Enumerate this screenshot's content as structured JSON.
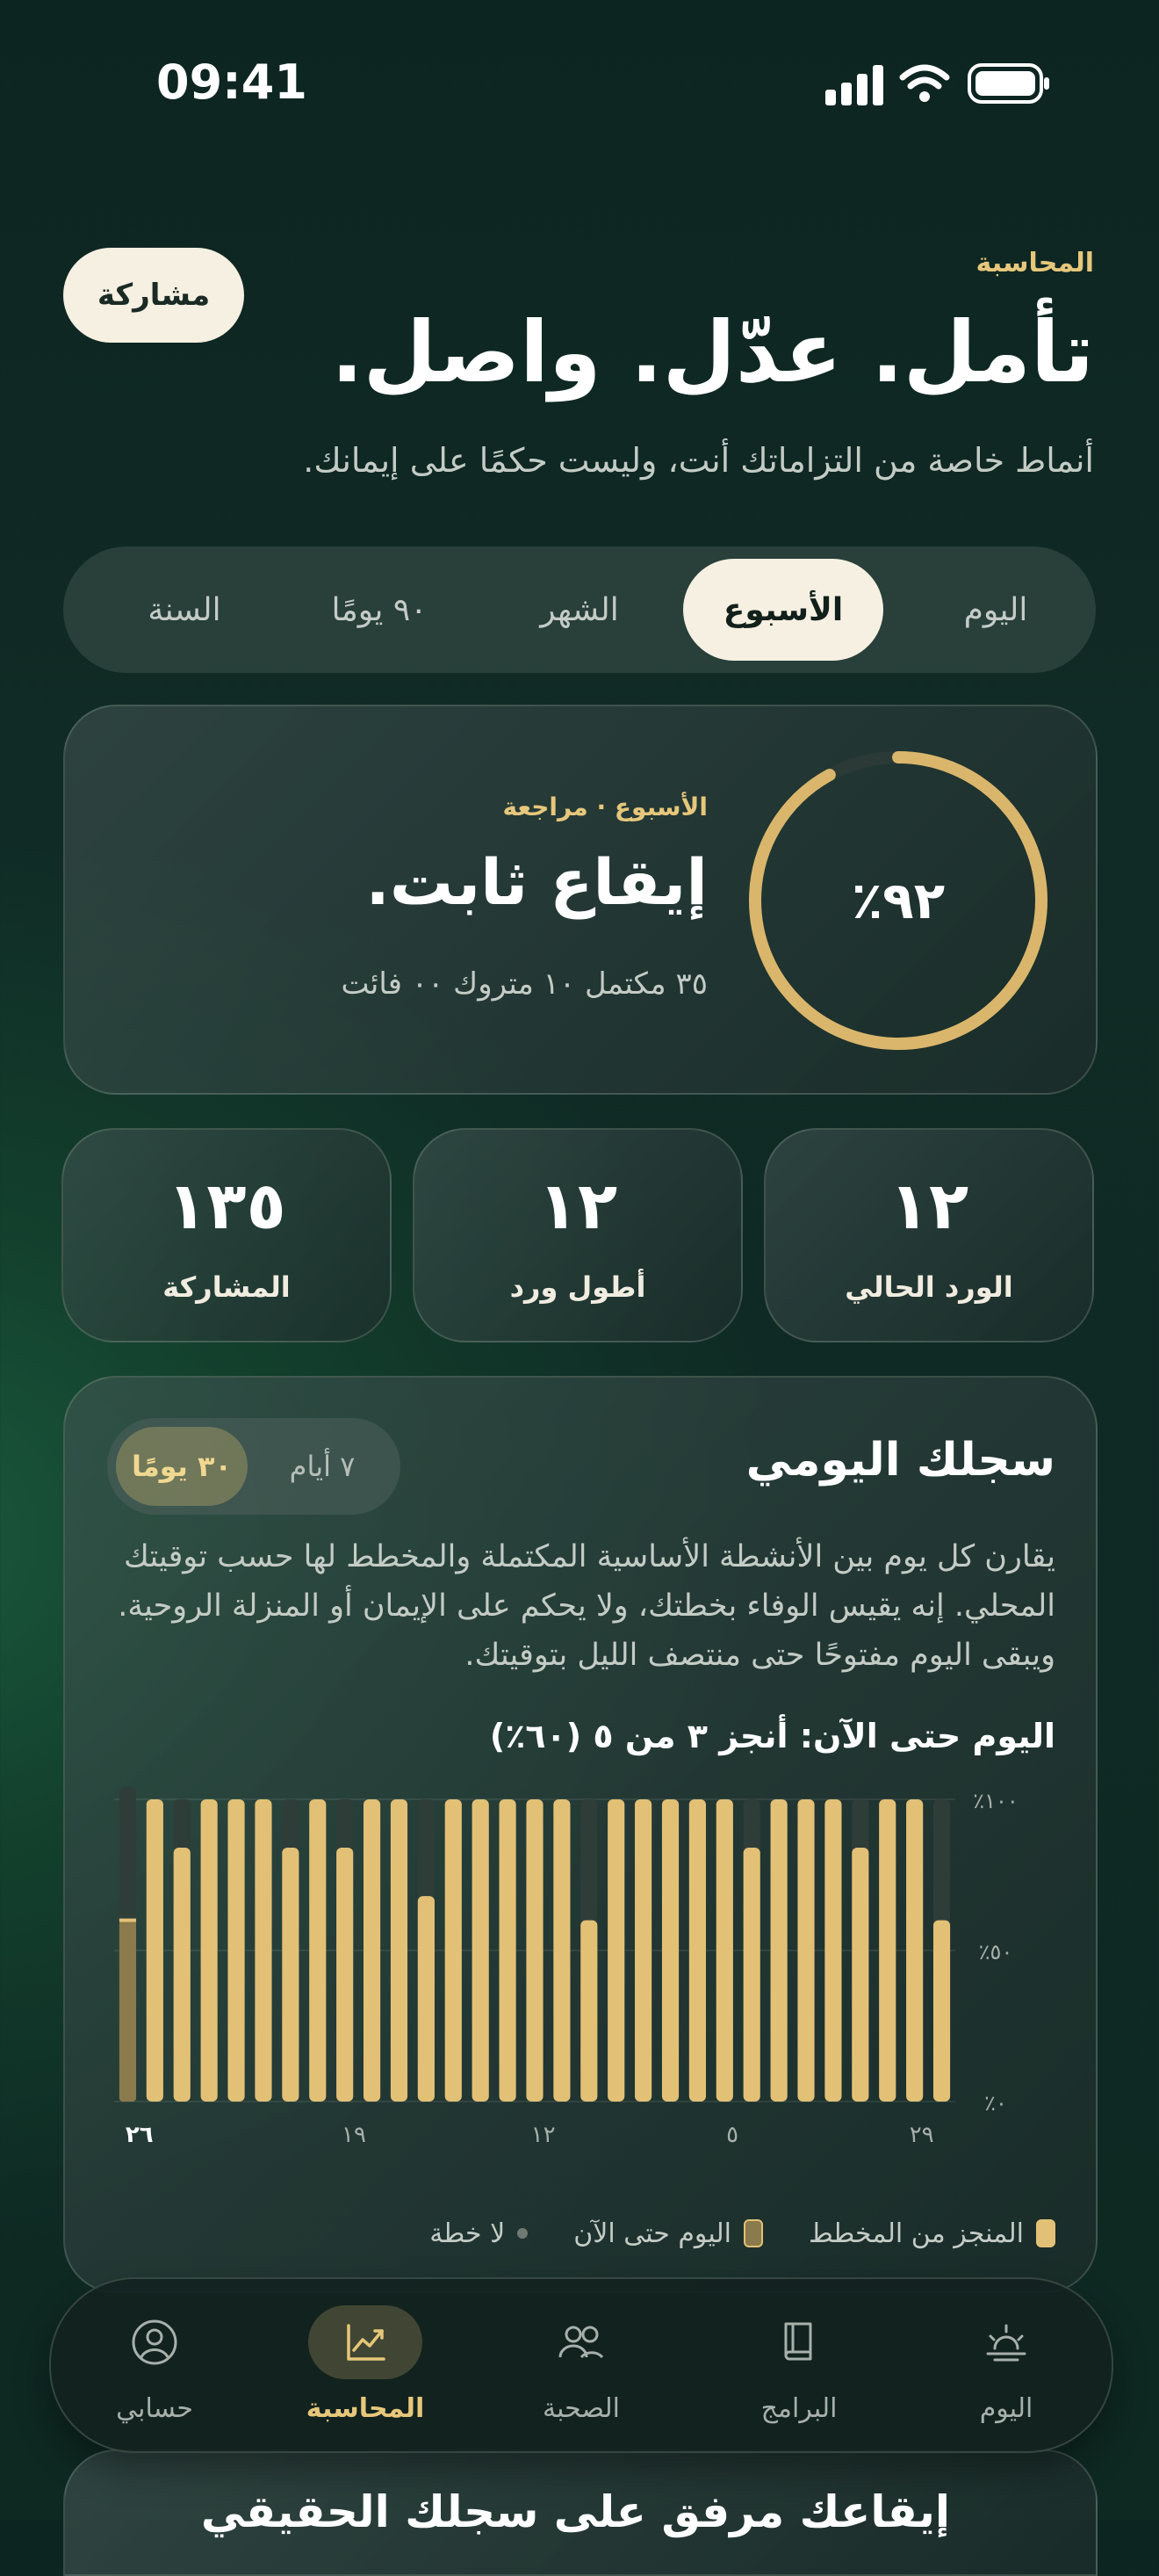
{
  "status": {
    "time": "09:41"
  },
  "header": {
    "eyebrow": "المحاسبة",
    "title": "تأمل. عدّل. واصل.",
    "subtitle": "أنماط خاصة من التزاماتك أنت، وليست حكمًا على إيمانك.",
    "share_label": "مشاركة"
  },
  "period_tabs": [
    {
      "label": "اليوم",
      "active": false
    },
    {
      "label": "الأسبوع",
      "active": true
    },
    {
      "label": "الشهر",
      "active": false
    },
    {
      "label": "٩٠ يومًا",
      "active": false
    },
    {
      "label": "السنة",
      "active": false
    }
  ],
  "summary": {
    "eyebrow": "الأسبوع · مراجعة",
    "title": "إيقاع ثابت.",
    "details": "٣٥ مكتمل ١٠ متروك ٠٠ فائت",
    "percent_label": "٩٢٪",
    "percent_value": 0.92
  },
  "stats": [
    {
      "value": "١٢",
      "label": "الورد الحالي"
    },
    {
      "value": "١٢",
      "label": "أطول ورد"
    },
    {
      "value": "١٣٥",
      "label": "المشاركة"
    }
  ],
  "log": {
    "title": "سجلك اليومي",
    "range_options": [
      {
        "label": "٧ أيام",
        "active": false
      },
      {
        "label": "٣٠ يومًا",
        "active": true
      }
    ],
    "description": "يقارن كل يوم بين الأنشطة الأساسية المكتملة والمخطط لها حسب توقيتك المحلي. إنه يقيس الوفاء بخطتك، ولا يحكم على الإيمان أو المنزلة الروحية. ويبقى اليوم مفتوحًا حتى منتصف الليل بتوقيتك.",
    "today_summary": "اليوم حتى الآن: أنجز ٣ من ٥ (٦٠٪)",
    "legend": [
      {
        "label": "المنجز من المخطط",
        "color": "#e2c176"
      },
      {
        "label": "اليوم حتى الآن",
        "color": "#8a7a4c"
      },
      {
        "label": "لا خطة",
        "color": "#6f7a74"
      }
    ]
  },
  "chart_data": {
    "type": "bar",
    "x_tick_labels": [
      "٢٩",
      "٥",
      "١٢",
      "١٩",
      "٢٦"
    ],
    "y_tick_labels": [
      "٠٪",
      "٥٠٪",
      "١٠٠٪"
    ],
    "ylim": [
      0,
      100
    ],
    "series": [
      {
        "name": "المنجز من المخطط",
        "values": [
          100,
          84,
          100,
          100,
          100,
          84,
          100,
          84,
          100,
          100,
          68,
          100,
          100,
          100,
          100,
          100,
          60,
          100,
          100,
          100,
          100,
          100,
          84,
          100,
          100,
          100,
          84,
          100,
          100,
          60
        ]
      }
    ],
    "today_value": 60,
    "today_position": "left",
    "colors": {
      "done": "#e2c176",
      "today": "#8a7a4c",
      "track": "#2f3d39"
    }
  },
  "nav": [
    {
      "label": "اليوم",
      "icon": "sunrise-icon",
      "active": false
    },
    {
      "label": "البرامج",
      "icon": "book-icon",
      "active": false
    },
    {
      "label": "الصحبة",
      "icon": "people-icon",
      "active": false
    },
    {
      "label": "المحاسبة",
      "icon": "chart-icon",
      "active": true
    },
    {
      "label": "حسابي",
      "icon": "profile-icon",
      "active": false
    }
  ],
  "peek": {
    "title": "إيقاعك مرفق على سجلك الحقيقي"
  }
}
